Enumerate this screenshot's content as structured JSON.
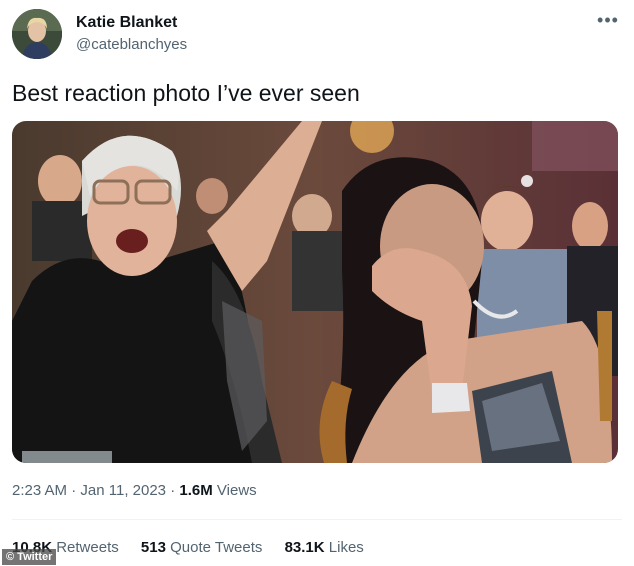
{
  "author": {
    "display_name": "Katie Blanket",
    "handle": "@cateblanchyes"
  },
  "tweet": {
    "text": "Best reaction photo I’ve ever seen"
  },
  "more_icon": "more-horizontal-icon",
  "meta": {
    "time": "2:23 AM",
    "separator": "·",
    "date": "Jan 11, 2023",
    "views_count": "1.6M",
    "views_label": "Views"
  },
  "stats": {
    "retweets_count": "10.8K",
    "retweets_label": "Retweets",
    "quotes_count": "513",
    "quotes_label": "Quote Tweets",
    "likes_count": "83.1K",
    "likes_label": "Likes"
  },
  "watermark": "© Twitter",
  "colors": {
    "text_primary": "#0f1419",
    "text_secondary": "#536471",
    "divider": "#eff3f4"
  }
}
